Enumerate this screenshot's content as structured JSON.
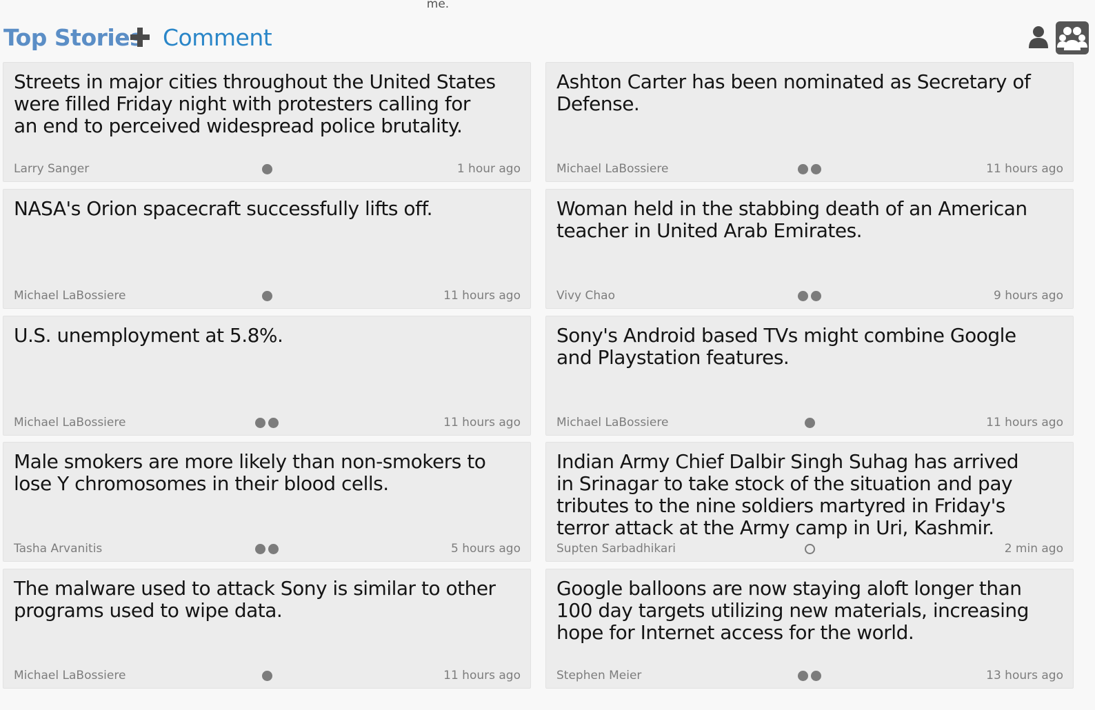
{
  "top_fragment": "me.",
  "header": {
    "title": "Top Stories",
    "comment_label": "Comment",
    "plus_icon": "plus-icon",
    "user_icon": "user-icon",
    "group_icon": "group-icon"
  },
  "stories": [
    {
      "headline": "Streets in major cities throughout the United States were filled Friday night with protesters calling for an end to perceived widespread police brutality.",
      "author": "Larry Sanger",
      "time": "1 hour ago",
      "dots": [
        "filled"
      ]
    },
    {
      "headline": "Ashton Carter has been nominated as Secretary of Defense.",
      "author": "Michael LaBossiere",
      "time": "11 hours ago",
      "dots": [
        "filled",
        "filled"
      ]
    },
    {
      "headline": "NASA's Orion spacecraft successfully lifts off.",
      "author": "Michael LaBossiere",
      "time": "11 hours ago",
      "dots": [
        "filled"
      ]
    },
    {
      "headline": "Woman held in the stabbing death of an American teacher in United Arab Emirates.",
      "author": "Vivy Chao",
      "time": "9 hours ago",
      "dots": [
        "filled",
        "filled"
      ]
    },
    {
      "headline": "U.S. unemployment at 5.8%.",
      "author": "Michael LaBossiere",
      "time": "11 hours ago",
      "dots": [
        "filled",
        "filled"
      ]
    },
    {
      "headline": "Sony's Android based TVs might combine Google and Playstation features.",
      "author": "Michael LaBossiere",
      "time": "11 hours ago",
      "dots": [
        "filled"
      ]
    },
    {
      "headline": "Male smokers are more likely than non-smokers to lose Y chromosomes in their blood cells.",
      "author": "Tasha Arvanitis",
      "time": "5 hours ago",
      "dots": [
        "filled",
        "filled"
      ]
    },
    {
      "headline": "Indian Army Chief Dalbir Singh Suhag has arrived in Srinagar to take stock of the situation and pay tributes to the nine soldiers martyred in Friday's terror attack at the Army camp in Uri, Kashmir.",
      "author": "Supten Sarbadhikari",
      "time": "2 min ago",
      "dots": [
        "empty"
      ]
    },
    {
      "headline": "The malware used to attack Sony is similar to other programs used to wipe data.",
      "author": "Michael LaBossiere",
      "time": "11 hours ago",
      "dots": [
        "filled"
      ]
    },
    {
      "headline": "Google balloons are now staying aloft longer than 100 day targets utilizing new materials, increasing hope for Internet access for the world.",
      "author": "Stephen Meier",
      "time": "13 hours ago",
      "dots": [
        "filled",
        "filled"
      ]
    }
  ]
}
